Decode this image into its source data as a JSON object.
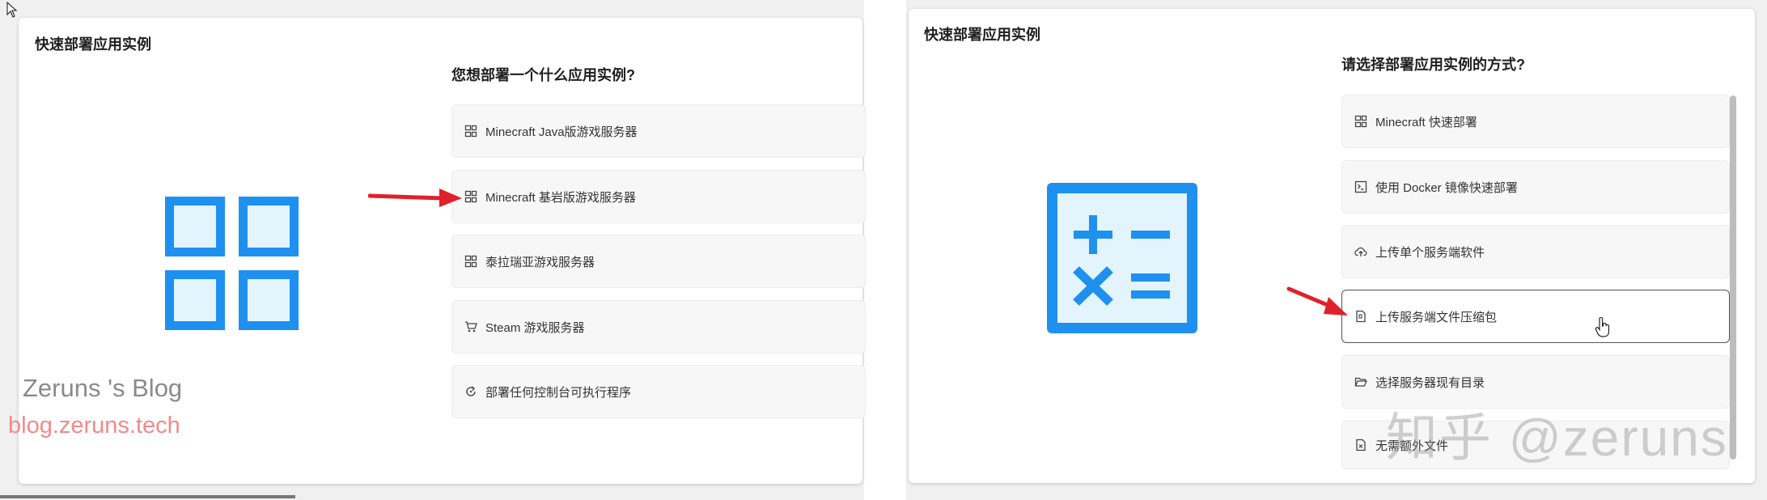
{
  "left_panel": {
    "title": "快速部署应用实例",
    "question": "您想部署一个什么应用实例?",
    "options": [
      {
        "label": "Minecraft Java版游戏服务器",
        "icon": "server-icon"
      },
      {
        "label": "Minecraft 基岩版游戏服务器",
        "icon": "server-icon"
      },
      {
        "label": "泰拉瑞亚游戏服务器",
        "icon": "server-icon"
      },
      {
        "label": "Steam 游戏服务器",
        "icon": "cart-icon"
      },
      {
        "label": "部署任何控制台可执行程序",
        "icon": "cycle-icon"
      }
    ]
  },
  "right_panel": {
    "title": "快速部署应用实例",
    "question": "请选择部署应用实例的方式?",
    "options": [
      {
        "label": "Minecraft 快速部署",
        "icon": "server-icon"
      },
      {
        "label": "使用 Docker 镜像快速部署",
        "icon": "terminal-icon"
      },
      {
        "label": "上传单个服务端软件",
        "icon": "cloud-upload-icon"
      },
      {
        "label": "上传服务端文件压缩包",
        "icon": "file-zip-icon"
      },
      {
        "label": "选择服务器现有目录",
        "icon": "folder-open-icon"
      },
      {
        "label": "无需额外文件",
        "icon": "file-x-icon"
      }
    ]
  },
  "watermarks": {
    "blog_name": "Zeruns 's Blog",
    "blog_url": "blog.zeruns.tech",
    "zhihu": "知乎 @zeruns"
  },
  "colors": {
    "accent_blue": "#1e90f0",
    "light_blue_fill": "#e3f4fd",
    "arrow_red": "#e0202a"
  }
}
